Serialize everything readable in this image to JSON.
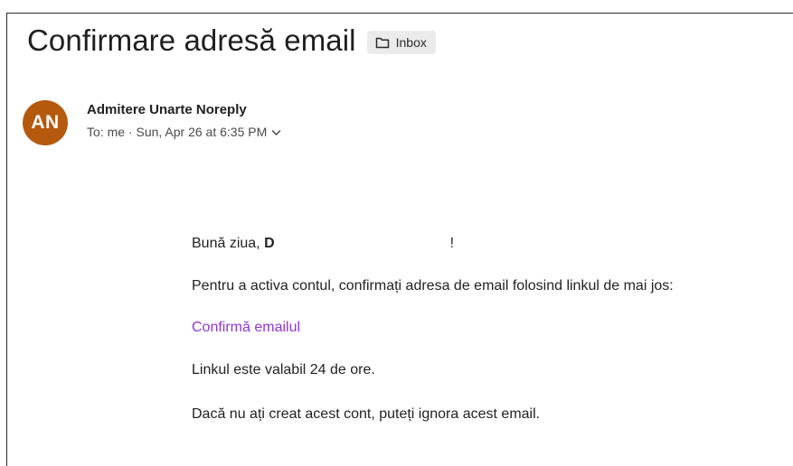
{
  "email": {
    "subject": "Confirmare adresă email",
    "folder": {
      "label": "Inbox",
      "icon": "folder-icon"
    },
    "sender": {
      "initials": "AN",
      "name": "Admitere Unarte Noreply",
      "avatar_color": "#b5590f"
    },
    "meta": {
      "to_label": "To:",
      "recipient": "me",
      "separator": "·",
      "date": "Sun, Apr 26 at 6:35 PM"
    }
  },
  "body": {
    "greeting_prefix": "Bună ziua,",
    "greeting_name_start": "D",
    "greeting_suffix": "!",
    "instructions": "Pentru a activa contul, confirmați adresa de email folosind linkul de mai jos:",
    "link_label": "Confirmă emailul",
    "validity": "Linkul este valabil 24 de ore.",
    "disclaimer": "Dacă nu ați creat acest cont, puteți ignora acest email."
  },
  "colors": {
    "link": "#8e35d6",
    "avatar": "#b5590f",
    "badge_bg": "#ebebeb"
  }
}
